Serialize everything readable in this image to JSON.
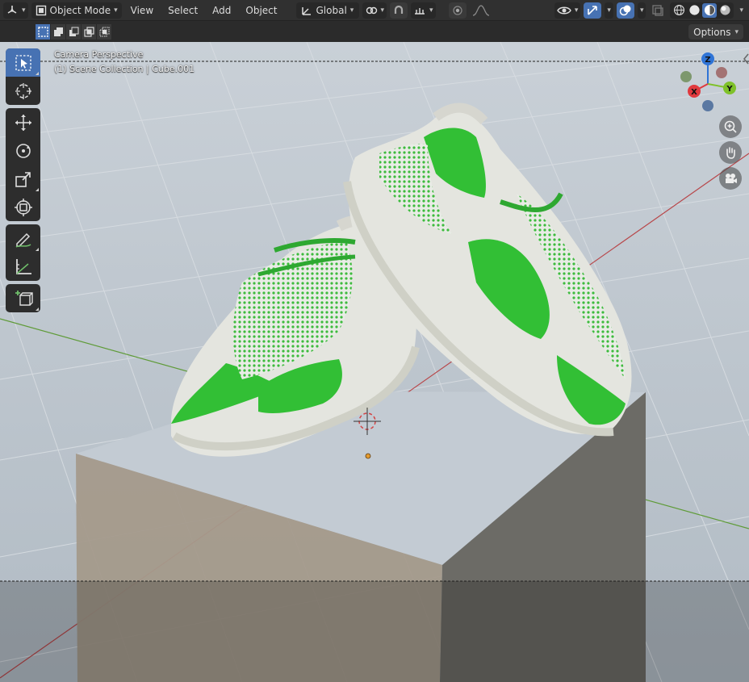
{
  "header": {
    "editor_type_icon": "3d-viewport-icon",
    "mode": {
      "label": "Object Mode",
      "icon": "object-mode-icon"
    },
    "menus": [
      "View",
      "Select",
      "Add",
      "Object"
    ],
    "transform_orientation": {
      "label": "Global",
      "icon": "orientation-icon"
    },
    "pivot_icon": "pivot-icon",
    "snap_icon": "magnet-icon",
    "snap_target_icon": "snap-increment-icon",
    "proportional_icon": "proportional-edit-icon",
    "falloff_icon": "falloff-curve-icon",
    "visibility_icon": "eye-icon",
    "gizmo_icon": "gizmo-icon",
    "overlay_icon": "overlay-icon",
    "xray_icon": "xray-icon",
    "shading_modes": [
      "wireframe",
      "solid",
      "material-preview",
      "rendered"
    ],
    "active_shading": "material-preview"
  },
  "tool_settings": {
    "selection_modes": [
      "set",
      "extend",
      "subtract",
      "invert",
      "intersect"
    ],
    "options_label": "Options"
  },
  "viewport": {
    "view_name": "Camera Perspective",
    "collection_info": "(1) Scene Collection | Cube.001"
  },
  "toolbar": {
    "groups": [
      [
        "select-box",
        "cursor"
      ],
      [
        "move",
        "rotate",
        "scale",
        "transform"
      ],
      [
        "annotate",
        "measure"
      ],
      [
        "add-cube"
      ]
    ],
    "active_tool": "select-box"
  },
  "navigation_gizmo": {
    "axes": [
      {
        "label": "Z",
        "color": "#2f74d6"
      },
      {
        "label": "Y",
        "color": "#7fc12a"
      },
      {
        "label": "X",
        "color": "#e0393e"
      }
    ],
    "buttons": [
      "zoom-icon",
      "pan-hand-icon",
      "camera-icon"
    ]
  },
  "colors": {
    "accent": "#4772b3",
    "header_bg": "#303030",
    "shoe_green": "#33c33a",
    "floor_bg": "#b7c0c9"
  }
}
